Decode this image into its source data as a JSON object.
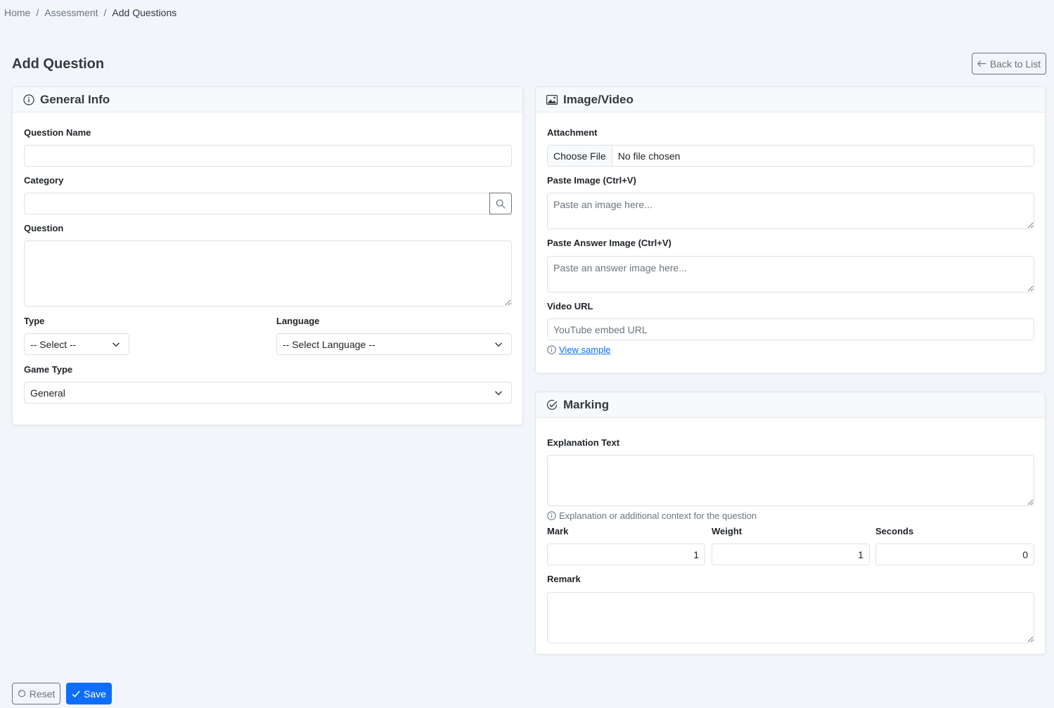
{
  "breadcrumb": {
    "items": [
      "Home",
      "Assessment",
      "Add Questions"
    ],
    "separator": "/"
  },
  "page": {
    "title": "Add Question",
    "back_label": "Back to List"
  },
  "general": {
    "title": "General Info",
    "question_name_label": "Question Name",
    "question_name_value": "",
    "category_label": "Category",
    "category_value": "",
    "question_label": "Question",
    "question_value": "",
    "type_label": "Type",
    "type_selected": "-- Select --",
    "language_label": "Language",
    "language_selected": "-- Select Language --",
    "game_type_label": "Game Type",
    "game_type_selected": "General"
  },
  "media": {
    "title": "Image/Video",
    "attachment_label": "Attachment",
    "choose_file": "Choose File",
    "no_file": "No file chosen",
    "paste_image_label": "Paste Image (Ctrl+V)",
    "paste_image_placeholder": "Paste an image here...",
    "paste_answer_label": "Paste Answer Image (Ctrl+V)",
    "paste_answer_placeholder": "Paste an answer image here...",
    "video_label": "Video URL",
    "video_placeholder": "YouTube embed URL",
    "view_sample": "View sample"
  },
  "marking": {
    "title": "Marking",
    "explanation_label": "Explanation Text",
    "explanation_value": "",
    "explanation_hint": "Explanation or additional context for the question",
    "mark_label": "Mark",
    "mark_value": "1",
    "weight_label": "Weight",
    "weight_value": "1",
    "seconds_label": "Seconds",
    "seconds_value": "0",
    "remark_label": "Remark",
    "remark_value": ""
  },
  "actions": {
    "reset_label": "Reset",
    "save_label": "Save"
  },
  "colors": {
    "primary": "#0d6efd",
    "secondary": "#6c757d",
    "background": "#f2f5f9"
  }
}
